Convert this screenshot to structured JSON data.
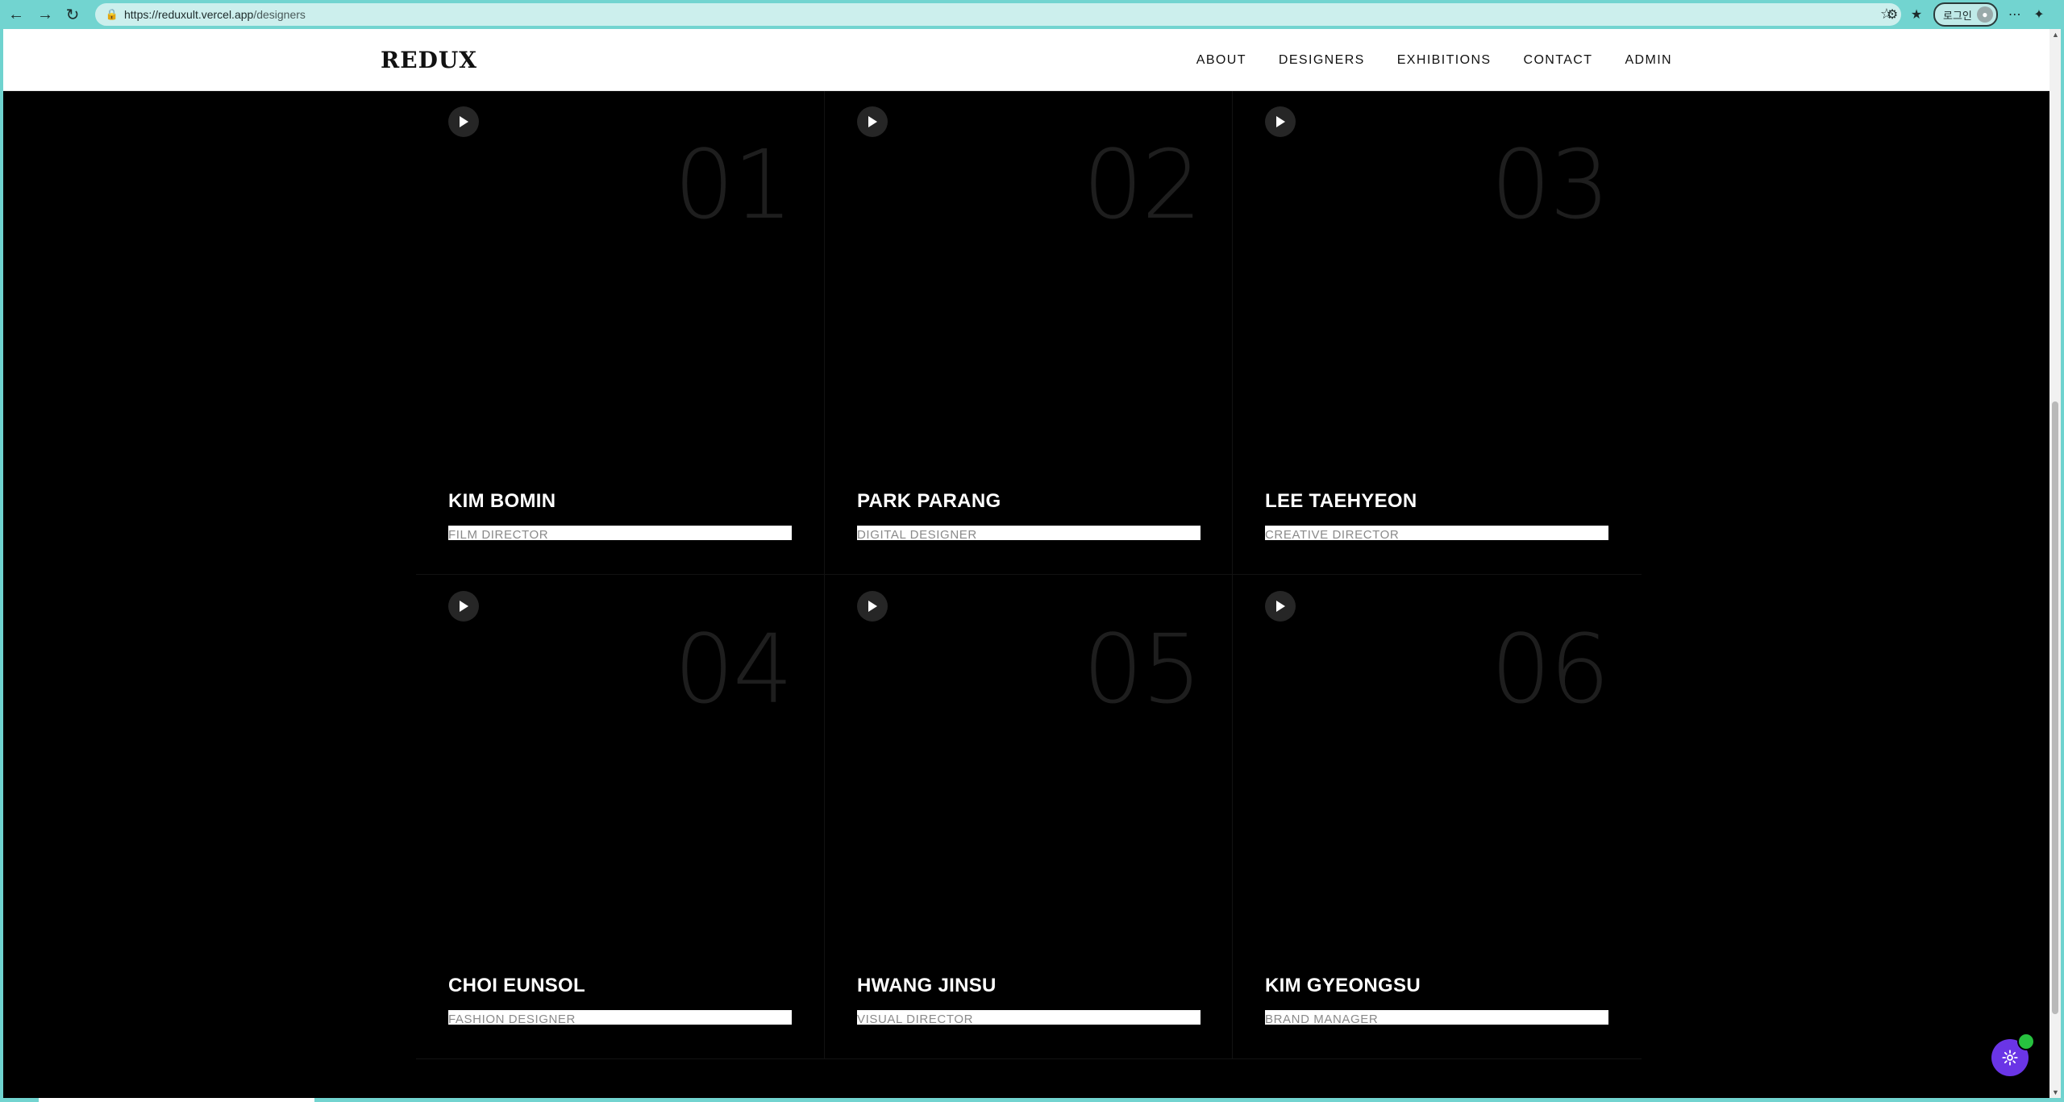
{
  "browser": {
    "url_host": "https://reduxult.vercel.app",
    "url_path": "/designers",
    "login_label": "로그인"
  },
  "site": {
    "logo": "REDUX",
    "nav": [
      "ABOUT",
      "DESIGNERS",
      "EXHIBITIONS",
      "CONTACT",
      "ADMIN"
    ]
  },
  "designers": [
    {
      "number": "01",
      "name": "KIM BOMIN",
      "role": "FILM DIRECTOR"
    },
    {
      "number": "02",
      "name": "PARK PARANG",
      "role": "DIGITAL DESIGNER"
    },
    {
      "number": "03",
      "name": "LEE TAEHYEON",
      "role": "CREATIVE DIRECTOR"
    },
    {
      "number": "04",
      "name": "CHOI EUNSOL",
      "role": "FASHION DESIGNER"
    },
    {
      "number": "05",
      "name": "HWANG JINSU",
      "role": "VISUAL DIRECTOR"
    },
    {
      "number": "06",
      "name": "KIM GYEONGSU",
      "role": "BRAND MANAGER"
    }
  ],
  "colors": {
    "chrome": "#72d4d0",
    "page_bg": "#000000",
    "fab": "#6a35e6",
    "fab_badge": "#27c13f"
  },
  "icons": {
    "play": "play-icon",
    "settings": "gear-icon"
  }
}
